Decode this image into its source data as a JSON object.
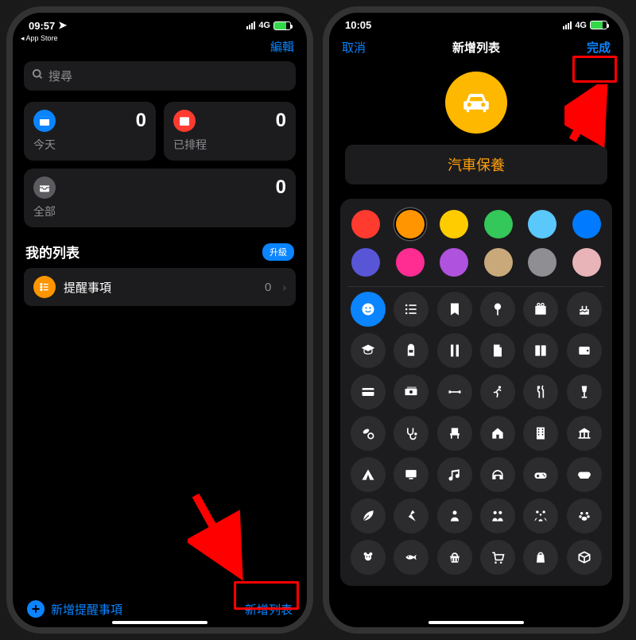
{
  "left": {
    "status": {
      "time": "09:57",
      "back_app": "◂ App Store",
      "carrier": "4G"
    },
    "nav": {
      "edit": "編輯"
    },
    "search": {
      "placeholder": "搜尋"
    },
    "cards": {
      "today": {
        "label": "今天",
        "count": "0"
      },
      "scheduled": {
        "label": "已排程",
        "count": "0"
      },
      "all": {
        "label": "全部",
        "count": "0"
      }
    },
    "section": {
      "my_lists": "我的列表",
      "upgrade": "升級"
    },
    "list": {
      "reminders": {
        "label": "提醒事項",
        "count": "0"
      }
    },
    "bottom": {
      "new_reminder": "新增提醒事項",
      "new_list": "新增列表"
    }
  },
  "right": {
    "status": {
      "time": "10:05",
      "carrier": "4G"
    },
    "nav": {
      "cancel": "取消",
      "title": "新增列表",
      "done": "完成"
    },
    "name_value": "汽車保養",
    "colors": [
      [
        "#ff3b30",
        "#ff9500",
        "#ffcc00",
        "#34c759",
        "#5ac8fa",
        "#007aff"
      ],
      [
        "#5856d6",
        "#ff2d92",
        "#af52de",
        "#c9a97a",
        "#8e8e93",
        "#e8b4b8"
      ]
    ],
    "selected_color_index": [
      0,
      1
    ],
    "icons": [
      [
        "smile",
        "list",
        "bookmark",
        "pin",
        "gift",
        "cake"
      ],
      [
        "grad",
        "backpack",
        "ruler",
        "doc",
        "book",
        "wallet"
      ],
      [
        "card",
        "money",
        "dumbbell",
        "run",
        "fork",
        "wine"
      ],
      [
        "pills",
        "steth",
        "chair",
        "house",
        "building",
        "bank"
      ],
      [
        "tent",
        "tv",
        "music",
        "headphone",
        "controller",
        "gamepad"
      ],
      [
        "leaf",
        "carrot",
        "person",
        "couple",
        "family",
        "paw"
      ],
      [
        "teddy",
        "fish",
        "basket",
        "cart",
        "bag",
        "box"
      ]
    ],
    "selected_icon": [
      0,
      0
    ]
  },
  "accent": "#0a84ff"
}
